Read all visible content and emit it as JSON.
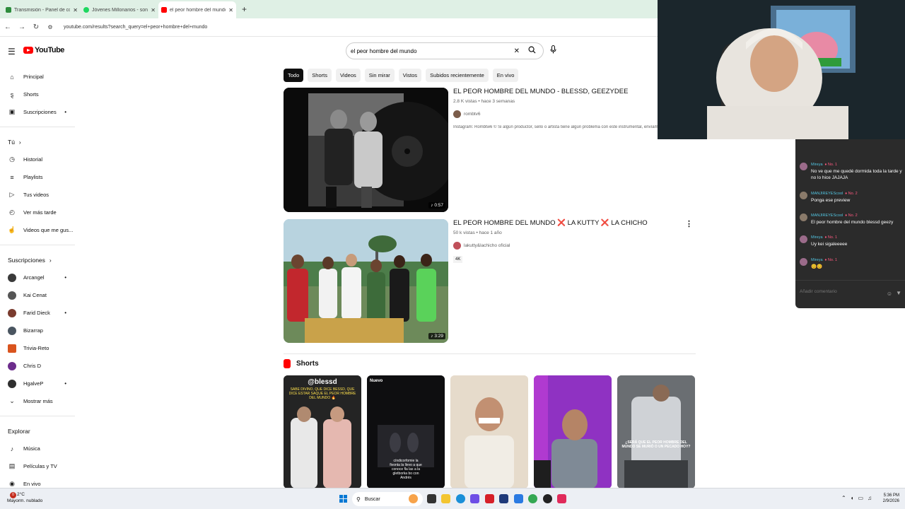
{
  "browser": {
    "tabs": [
      {
        "title": "Transmisión - Panel de control",
        "color": "#2d8c3c"
      },
      {
        "title": "Jóvenes Millonarios - song and",
        "color": "#1ed760"
      },
      {
        "title": "el peor hombre del mundo - YouTube",
        "color": "#ff0000"
      }
    ],
    "new_tab": "+",
    "url": "youtube.com/results?search_query=el+peor+hombre+del+mundo"
  },
  "header": {
    "logo_text": "YouTube",
    "search_value": "el peor hombre del mundo",
    "clear_icon": "✕",
    "search_icon": "🔍",
    "mic_icon": "🎤"
  },
  "sidebar": {
    "main": [
      {
        "label": "Principal",
        "icon": "home-icon"
      },
      {
        "label": "Shorts",
        "icon": "shorts-icon"
      },
      {
        "label": "Suscripciones",
        "icon": "subscriptions-icon"
      }
    ],
    "you_heading": "Tú",
    "you": [
      {
        "label": "Historial",
        "icon": "history-icon"
      },
      {
        "label": "Playlists",
        "icon": "playlist-icon"
      },
      {
        "label": "Tus videos",
        "icon": "your-videos-icon"
      },
      {
        "label": "Ver más tarde",
        "icon": "watch-later-icon"
      },
      {
        "label": "Videos que me gus...",
        "icon": "like-icon"
      }
    ],
    "subs_heading": "Suscripciones",
    "subs": [
      {
        "label": "Arcangel",
        "color": "#3a3a3a",
        "dot": true
      },
      {
        "label": "Kai Cenat",
        "color": "#555555",
        "dot": false
      },
      {
        "label": "Farid Dieck",
        "color": "#7a3b2e",
        "dot": true
      },
      {
        "label": "Bizarrap",
        "color": "#4a5560",
        "dot": false
      },
      {
        "label": "Trivia-Reto",
        "color": "#d9541e",
        "dot": false
      },
      {
        "label": "Chris D",
        "color": "#6c2c8c",
        "dot": false
      },
      {
        "label": "HgalveP",
        "color": "#2f2f2f",
        "dot": true
      }
    ],
    "show_more": "Mostrar más",
    "explore_heading": "Explorar",
    "explore": [
      {
        "label": "Música",
        "icon": "music-icon"
      },
      {
        "label": "Películas y TV",
        "icon": "movies-icon"
      },
      {
        "label": "En vivo",
        "icon": "live-icon"
      }
    ]
  },
  "chips": [
    "Todo",
    "Shorts",
    "Videos",
    "Sin mirar",
    "Vistos",
    "Subidos recientemente",
    "En vivo"
  ],
  "videos": [
    {
      "title": "EL PEOR HOMBRE DEL MUNDO - BLESSD, GEEZYDEE",
      "meta": "2.8 K vistas • hace 3 semanas",
      "channel": "rombtv6",
      "description": "Instagram: Rombtw6 © Si algún productor, sello o artista tiene algún problema con este instrumental, envíame un c",
      "duration": "0:57"
    },
    {
      "title": "EL PEOR HOMBRE DEL MUNDO ❌ LA KUTTY ❌ LA CHICHO",
      "meta": "50 k vistas • hace 1 año",
      "channel": "lakutty&lachicho oficial",
      "badge": "4K",
      "duration": "3:29"
    }
  ],
  "shorts": {
    "heading": "Shorts",
    "items": [
      {
        "overlay_top": "@blessd",
        "overlay_text": "SABE DIVINO, QUE DICE BESSD, QUE DICE ESTAR SAQUE EL PEOR HOMBRE DEL MUNDO 🔥"
      },
      {
        "overlay_top": "Nuevo",
        "overlay_text": "cíndicorfomie la fivonta la llevo a que conoce fla las a la gletborka bo con Andrés"
      },
      {
        "overlay_top": "",
        "overlay_text": ""
      },
      {
        "overlay_top": "",
        "overlay_text": ""
      },
      {
        "overlay_top": "",
        "overlay_text": "¿SERÁ QUE EL PEOR HOMBRE DEL MUNDO SE MURIÓ O UN PECADO HOY?"
      }
    ]
  },
  "chat": {
    "messages": [
      {
        "name": "Mireya",
        "rank": "No. 1",
        "text": "No ve que me quedé dormida toda la tarde y no lo hice JAJAJA",
        "color": "#9b6b8a"
      },
      {
        "name": "MANJIREYEScool",
        "rank": "No. 2",
        "text": "Ponga ese preview",
        "color": "#8a7a6a"
      },
      {
        "name": "MANJIREYEScool",
        "rank": "No. 2",
        "text": "El peor hombre del mundo blessd geezy",
        "color": "#8a7a6a"
      },
      {
        "name": "Mireya",
        "rank": "No. 1",
        "text": "Uy kei sigaleeeee",
        "color": "#9b6b8a"
      },
      {
        "name": "Mireya",
        "rank": "No. 1",
        "text": "😊😊",
        "color": "#9b6b8a"
      }
    ],
    "input_placeholder": "Añadir comentario"
  },
  "taskbar": {
    "weather_temp": "2°C",
    "weather_desc": "Mayorm. nublado",
    "weather_badge": "0",
    "search_label": "Buscar",
    "time": "5:36 PM",
    "date": "2/9/2026"
  }
}
